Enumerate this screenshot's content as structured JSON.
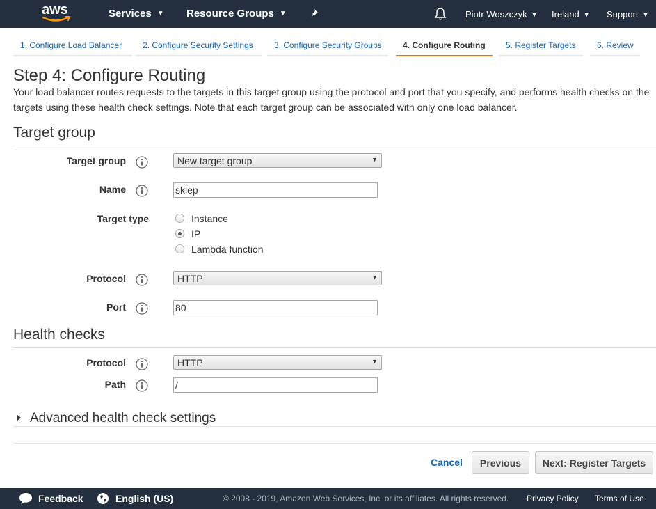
{
  "header": {
    "logo_text": "aws",
    "services_label": "Services",
    "resource_groups_label": "Resource Groups",
    "user_label": "Piotr Woszczyk",
    "region_label": "Ireland",
    "support_label": "Support"
  },
  "wizard": {
    "steps": [
      {
        "label": "1. Configure Load Balancer",
        "active": false
      },
      {
        "label": "2. Configure Security Settings",
        "active": false
      },
      {
        "label": "3. Configure Security Groups",
        "active": false
      },
      {
        "label": "4. Configure Routing",
        "active": true
      },
      {
        "label": "5. Register Targets",
        "active": false
      },
      {
        "label": "6. Review",
        "active": false
      }
    ]
  },
  "page": {
    "title": "Step 4: Configure Routing",
    "intro": "Your load balancer routes requests to the targets in this target group using the protocol and port that you specify, and performs health checks on the targets using these health check settings. Note that each target group can be associated with only one load balancer."
  },
  "target_group": {
    "section_title": "Target group",
    "target_group_label": "Target group",
    "target_group_value": "New target group",
    "name_label": "Name",
    "name_value": "sklep",
    "target_type_label": "Target type",
    "target_type_options": [
      "Instance",
      "IP",
      "Lambda function"
    ],
    "target_type_selected": "IP",
    "protocol_label": "Protocol",
    "protocol_value": "HTTP",
    "port_label": "Port",
    "port_value": "80"
  },
  "health_checks": {
    "section_title": "Health checks",
    "protocol_label": "Protocol",
    "protocol_value": "HTTP",
    "path_label": "Path",
    "path_value": "/",
    "advanced_label": "Advanced health check settings"
  },
  "actions": {
    "cancel_label": "Cancel",
    "previous_label": "Previous",
    "next_label": "Next: Register Targets"
  },
  "footer": {
    "feedback_label": "Feedback",
    "language_label": "English (US)",
    "copyright": "© 2008 - 2019, Amazon Web Services, Inc. or its affiliates. All rights reserved.",
    "privacy_label": "Privacy Policy",
    "terms_label": "Terms of Use"
  },
  "colors": {
    "nav_background": "#232f3e",
    "link_blue": "#1166bb",
    "active_step_accent": "#ec7211"
  }
}
